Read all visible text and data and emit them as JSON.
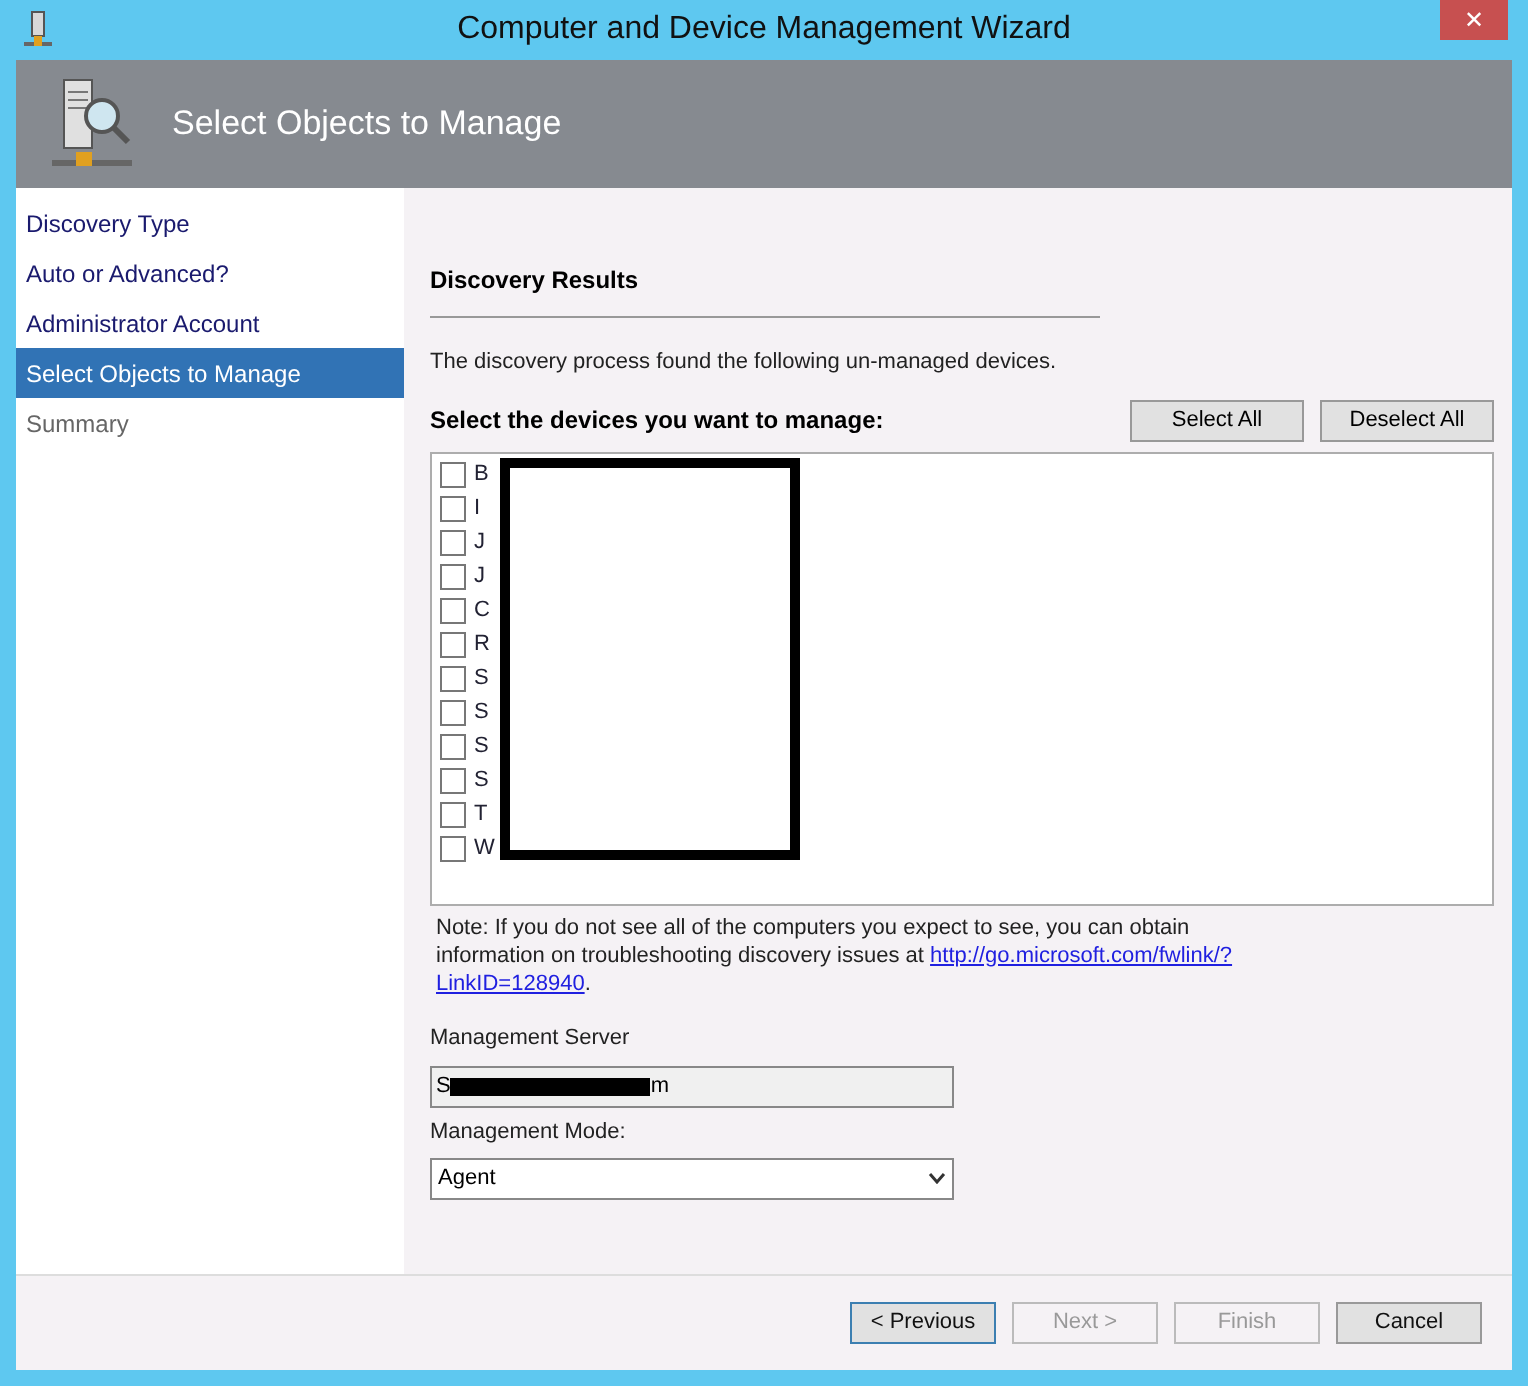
{
  "window": {
    "title": "Computer and Device Management Wizard",
    "close": "✕"
  },
  "header": {
    "title": "Select Objects to Manage"
  },
  "sidebar": {
    "items": [
      {
        "label": "Discovery Type",
        "selected": false,
        "disabled": false
      },
      {
        "label": "Auto or Advanced?",
        "selected": false,
        "disabled": false
      },
      {
        "label": "Administrator Account",
        "selected": false,
        "disabled": false
      },
      {
        "label": "Select Objects to Manage",
        "selected": true,
        "disabled": false
      },
      {
        "label": "Summary",
        "selected": false,
        "disabled": true
      }
    ]
  },
  "section_title": "Discovery Results",
  "description": "The discovery process found the following un-managed devices.",
  "devices_label": "Select the devices you want to manage:",
  "select_all": "Select All",
  "deselect_all": "Deselect All",
  "devices": [
    {
      "label": "B",
      "checked": false
    },
    {
      "label": "I",
      "checked": false
    },
    {
      "label": "J",
      "checked": false
    },
    {
      "label": "J",
      "checked": false
    },
    {
      "label": "C",
      "checked": false
    },
    {
      "label": "R",
      "checked": false
    },
    {
      "label": "S",
      "checked": false
    },
    {
      "label": "S",
      "checked": false
    },
    {
      "label": "S",
      "checked": false
    },
    {
      "label": "S",
      "checked": false
    },
    {
      "label": "T",
      "checked": false
    },
    {
      "label": "W",
      "checked": false
    }
  ],
  "note": {
    "text": "Note: If you do not see all of the computers you expect to see, you can obtain information on troubleshooting discovery issues at",
    "link": [
      "http://go.microsoft.com/fwlink/?",
      "LinkID=128940"
    ],
    "end": "."
  },
  "management_server": {
    "label": "Management Server",
    "value_start": "S",
    "value_end": "m"
  },
  "management_mode": {
    "label": "Management Mode:",
    "value": "Agent"
  },
  "buttons": [
    {
      "label": "< Previous",
      "disabled": false
    },
    {
      "label": "Next >",
      "disabled": true
    },
    {
      "label": "Finish",
      "disabled": true
    },
    {
      "label": "Cancel",
      "disabled": false
    }
  ]
}
